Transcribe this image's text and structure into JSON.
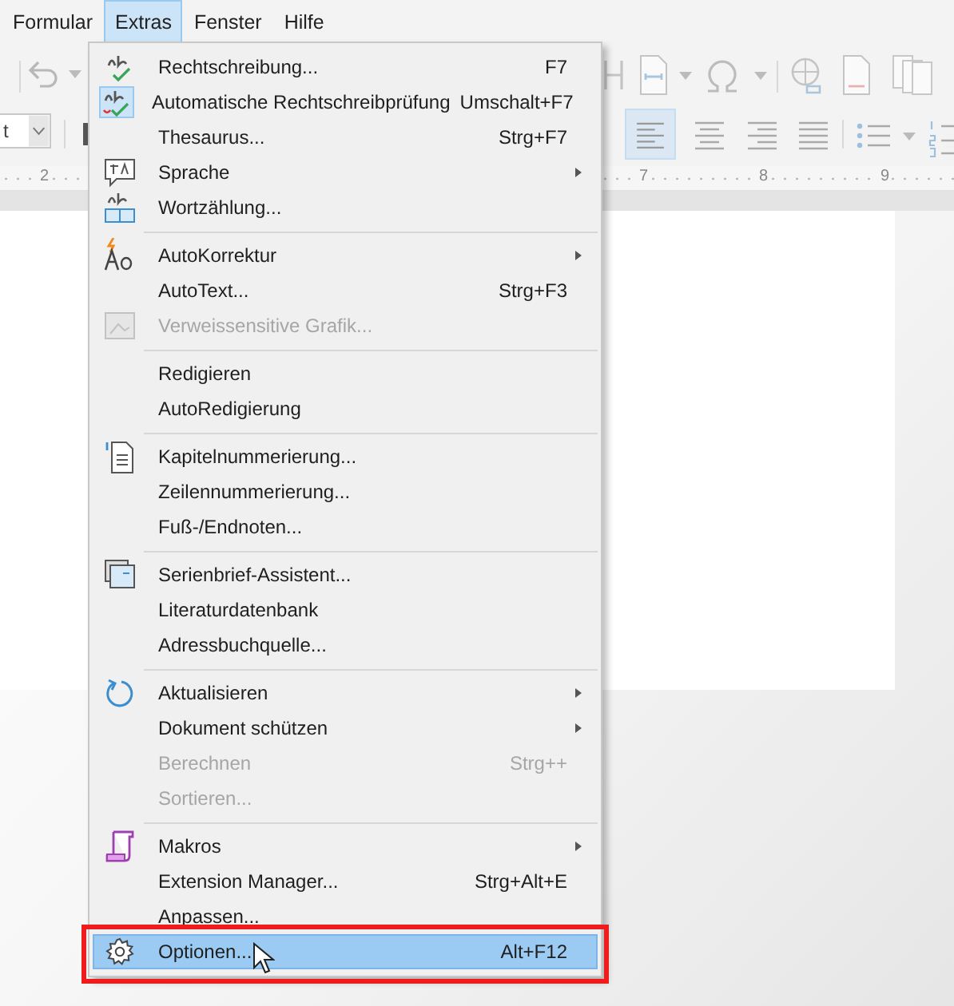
{
  "menubar": [
    {
      "label": "Formular",
      "selected": false
    },
    {
      "label": "Extras",
      "selected": true
    },
    {
      "label": "Fenster",
      "selected": false
    },
    {
      "label": "Hilfe",
      "selected": false
    }
  ],
  "toolbar": {
    "font_box_value": "t"
  },
  "ruler": {
    "numbers": [
      "2",
      "7",
      "8",
      "9"
    ]
  },
  "menu": {
    "groups": [
      [
        {
          "label": "Rechtschreibung...",
          "shortcut": "F7",
          "submenu": false,
          "disabled": false,
          "checked": false,
          "selected": false
        },
        {
          "label": "Automatische Rechtschreibprüfung",
          "shortcut": "Umschalt+F7",
          "submenu": false,
          "disabled": false,
          "checked": true,
          "selected": false
        },
        {
          "label": "Thesaurus...",
          "shortcut": "Strg+F7",
          "submenu": false,
          "disabled": false,
          "checked": false,
          "selected": false
        },
        {
          "label": "Sprache",
          "submenu": true,
          "disabled": false,
          "checked": false,
          "selected": false
        },
        {
          "label": "Wortzählung...",
          "submenu": false,
          "disabled": false,
          "checked": false,
          "selected": false
        }
      ],
      [
        {
          "label": "AutoKorrektur",
          "submenu": true,
          "disabled": false,
          "checked": false,
          "selected": false
        },
        {
          "label": "AutoText...",
          "shortcut": "Strg+F3",
          "submenu": false,
          "disabled": false,
          "checked": false,
          "selected": false
        },
        {
          "label": "Verweissensitive Grafik...",
          "submenu": false,
          "disabled": true,
          "checked": false,
          "selected": false
        }
      ],
      [
        {
          "label": "Redigieren",
          "submenu": false,
          "disabled": false,
          "checked": false,
          "selected": false
        },
        {
          "label": "AutoRedigierung",
          "submenu": false,
          "disabled": false,
          "checked": false,
          "selected": false
        }
      ],
      [
        {
          "label": "Kapitelnummerierung...",
          "submenu": false,
          "disabled": false,
          "checked": false,
          "selected": false
        },
        {
          "label": "Zeilennummerierung...",
          "submenu": false,
          "disabled": false,
          "checked": false,
          "selected": false
        },
        {
          "label": "Fuß-/Endnoten...",
          "submenu": false,
          "disabled": false,
          "checked": false,
          "selected": false
        }
      ],
      [
        {
          "label": "Serienbrief-Assistent...",
          "submenu": false,
          "disabled": false,
          "checked": false,
          "selected": false
        },
        {
          "label": "Literaturdatenbank",
          "submenu": false,
          "disabled": false,
          "checked": false,
          "selected": false
        },
        {
          "label": "Adressbuchquelle...",
          "submenu": false,
          "disabled": false,
          "checked": false,
          "selected": false
        }
      ],
      [
        {
          "label": "Aktualisieren",
          "submenu": true,
          "disabled": false,
          "checked": false,
          "selected": false
        },
        {
          "label": "Dokument schützen",
          "submenu": true,
          "disabled": false,
          "checked": false,
          "selected": false
        },
        {
          "label": "Berechnen",
          "shortcut": "Strg++",
          "submenu": false,
          "disabled": true,
          "checked": false,
          "selected": false
        },
        {
          "label": "Sortieren...",
          "submenu": false,
          "disabled": true,
          "checked": false,
          "selected": false
        }
      ],
      [
        {
          "label": "Makros",
          "submenu": true,
          "disabled": false,
          "checked": false,
          "selected": false
        },
        {
          "label": "Extension Manager...",
          "shortcut": "Strg+Alt+E",
          "submenu": false,
          "disabled": false,
          "checked": false,
          "selected": false
        },
        {
          "label": "Anpassen...",
          "submenu": false,
          "disabled": false,
          "checked": false,
          "selected": false
        },
        {
          "label": "Optionen...",
          "shortcut": "Alt+F12",
          "submenu": false,
          "disabled": false,
          "checked": false,
          "selected": true
        }
      ]
    ]
  }
}
